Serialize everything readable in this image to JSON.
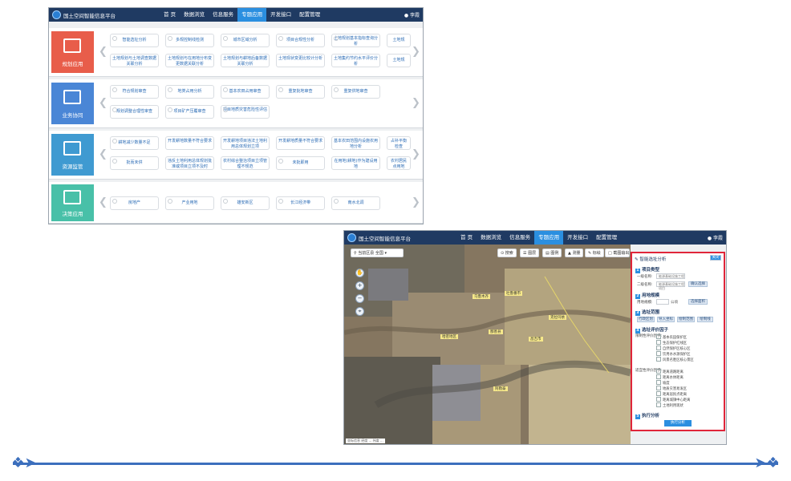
{
  "app_title": "国土空间智能信息平台",
  "nav": [
    "首 页",
    "数据浏览",
    "信息服务",
    "专题应用",
    "开发接口",
    "配置管理"
  ],
  "nav_active_index": 3,
  "user_label": "李霞",
  "colors": {
    "topbar": "#1f3a62",
    "active": "#2b8fe0",
    "planning": "#e85d4a",
    "collab": "#4a86d6",
    "monitor": "#3f9ad1",
    "decision": "#48c0a8",
    "panel_border": "#e0253a"
  },
  "rows": [
    {
      "label": "规划应用",
      "icon": "grid-icon",
      "cards_top": [
        "智能选址分析",
        "多规控制线检测",
        "城市区域分析",
        "项目合规性分析",
        "土地规划基本指标查询分析",
        "土地规"
      ],
      "cards_bottom": [
        "土地规划与土地调查数据关联分析",
        "土地规划与在用地分布变更数据关联分析",
        "土地规划与耕地后备数据关联分析",
        "土地现状变更比较计分析",
        "土地集约节约水平评价分析",
        "土地规"
      ]
    },
    {
      "label": "业务协同",
      "icon": "document-check-icon",
      "cards_top": [
        "符合规划审查",
        "地类占用分析",
        "基本农田占用审查",
        "重复批地审查",
        "重复供地审查"
      ],
      "cards_bottom": [
        "规划调整合理性审查",
        "项目矿产压覆审查",
        "项目地质灾害危险性评估"
      ]
    },
    {
      "label": "资源监管",
      "icon": "monitor-icon",
      "cards_top": [
        "耕地减少数量不足",
        "开发耕地数量不符合要求",
        "开发耕地项目违法土地利用总体规划立项",
        "开发耕地质量不符合要求",
        "基本农田范围内设施农用地分析",
        "占补平衡检查"
      ],
      "cards_bottom": [
        "批而未供",
        "违反土地利用总体规划批准或项目立项不及时",
        "农村综合整治项目立项管理不规范",
        "未批即用",
        "在用地(耕地)作为建设用地",
        "农村居民点用地"
      ]
    },
    {
      "label": "决策应用",
      "icon": "edit-list-icon",
      "cards_top": [
        "房地产",
        "产业用地",
        "雄安新区",
        "长江经济带",
        "南水北调"
      ],
      "cards_bottom": []
    }
  ],
  "map_toolbar": [
    "当前区县 全国",
    "搜索",
    "图层",
    "图例",
    "测量",
    "标绘",
    "截图输出"
  ],
  "map_labels": [
    "乌鲁木齐",
    "吐鲁番市",
    "克拉玛依",
    "哈密地区",
    "鄯善县",
    "昌吉市",
    "阿勒泰"
  ],
  "map_status": "坐标信息 经度 ... 纬度 ...",
  "panel": {
    "title": "智能选址分析",
    "close": "关闭",
    "sections": [
      "项目类型",
      "用地规模",
      "选址范围",
      "选址评价因子",
      "执行分析"
    ],
    "industry_label": "一级名称:",
    "industry_value": "能源基础设施工程",
    "sub_label": "二级名称:",
    "sub_value": "能源基础设施工程项目",
    "confirm": "确认选择",
    "area_label": "用地规模:",
    "area_unit": "公顷",
    "area_btn": "选择面积",
    "range_buttons": [
      "行政区划",
      "导入坐标",
      "绘制范围",
      "绘制线"
    ],
    "factor_group1": "限制性评价因子:",
    "factors1": [
      "基本农田保护区",
      "生态保护红线区",
      "自然保护区核心区",
      "饮用水水源保护区",
      "风景名胜区核心景区"
    ],
    "factor_group2": "适宜性评价因子:",
    "factors2": [
      "距离道路距离",
      "距离水体距离",
      "坡度",
      "地质灾害易发区",
      "距离居民点距离",
      "距离城镇中心距离",
      "土地利用现状"
    ],
    "run": "执行分析"
  }
}
